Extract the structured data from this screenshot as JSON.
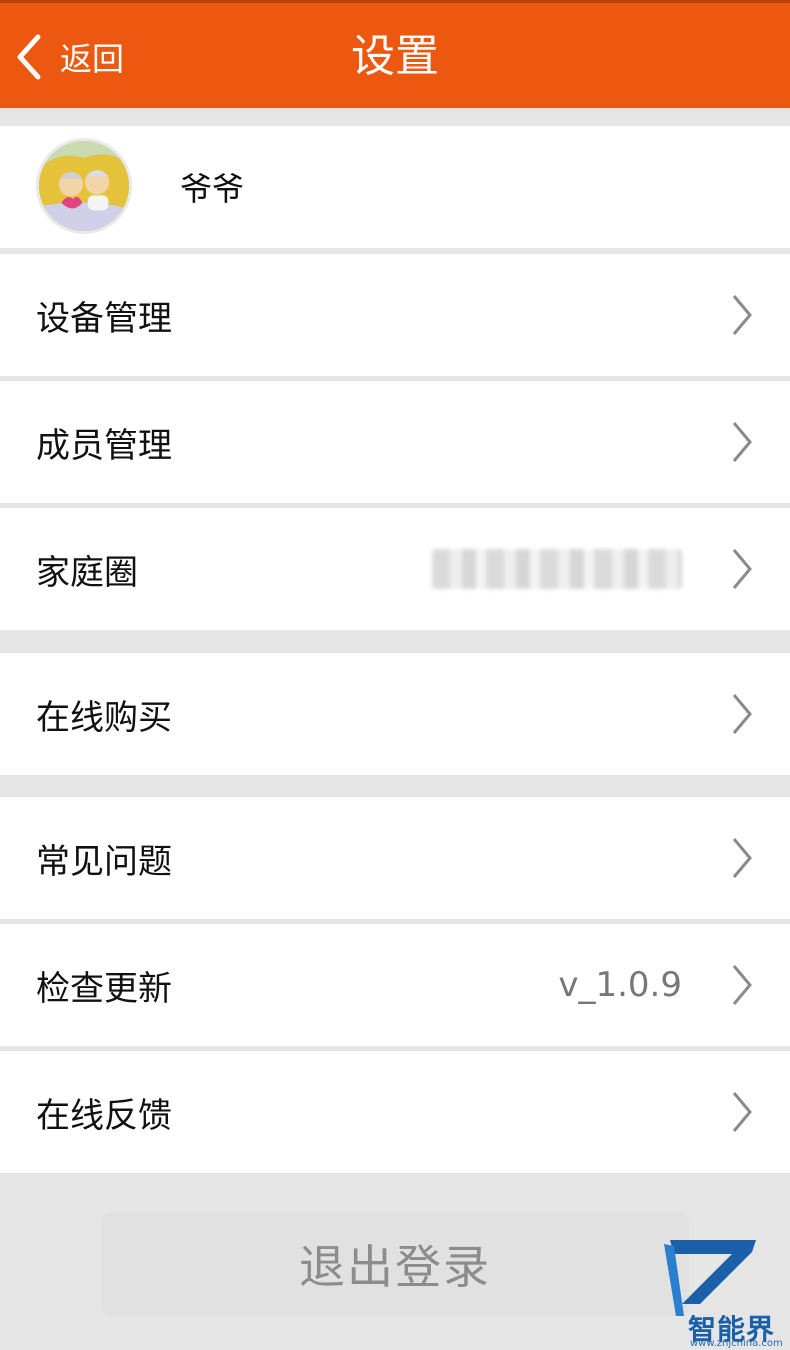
{
  "header": {
    "back_label": "返回",
    "title": "设置",
    "background_color": "#ec5810"
  },
  "profile": {
    "name": "爷爷",
    "avatar": "elderly-couple-cartoon-avatar"
  },
  "menu": {
    "device_management": "设备管理",
    "member_management": "成员管理",
    "family_circle": "家庭圈",
    "buy_online": "在线购买",
    "faq": "常见问题",
    "check_update": "检查更新",
    "version": "v_1.0.9",
    "feedback": "在线反馈"
  },
  "logout": {
    "label": "退出登录"
  },
  "watermark": {
    "text": "智能界",
    "url": "www.znjchina.com"
  },
  "icons": {
    "back": "chevron-left-icon",
    "row": "chevron-right-icon"
  }
}
